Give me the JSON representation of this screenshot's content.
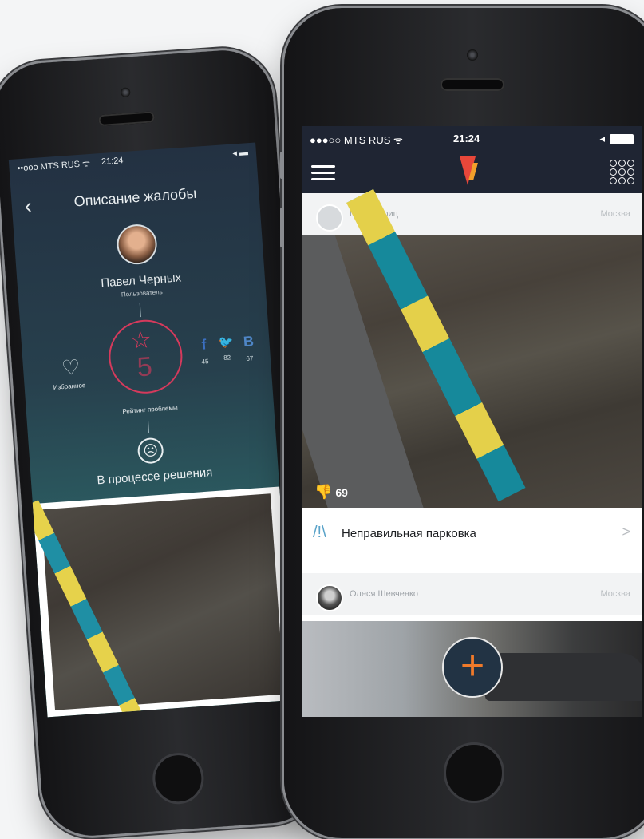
{
  "left_screen": {
    "status": {
      "carrier": "••ooo MTS RUS ᯤ",
      "time": "21:24",
      "signal": "◂ ▬"
    },
    "back_glyph": "‹",
    "title": "Описание жалобы",
    "user": {
      "name": "Павел Черных",
      "role": "Пользователь"
    },
    "favorite": {
      "glyph": "♡",
      "label": "Избранное"
    },
    "rating": {
      "glyph": "☆",
      "value": "5",
      "label": "Рейтинг проблемы"
    },
    "social": [
      {
        "icon": "facebook-icon",
        "glyph": "f",
        "count": "45",
        "color": "#3b6fbf"
      },
      {
        "icon": "twitter-icon",
        "glyph": "🐦",
        "count": "82",
        "color": "#2aa9e0"
      },
      {
        "icon": "vk-icon",
        "glyph": "B",
        "count": "67",
        "color": "#4f86c6"
      }
    ],
    "status_text": "В процессе решения",
    "status_glyph": "☹"
  },
  "right_screen": {
    "status": {
      "carrier": "●●●○○ MTS RUS ᯤ",
      "time": "21:24",
      "signal": "◂"
    },
    "posts": [
      {
        "author": "Павел Дриц",
        "location": "Москва",
        "dislikes": "69",
        "category": "Неправильная парковка",
        "category_glyph": "/!\\",
        "arrow": ">"
      },
      {
        "author": "Олеся Шевченко",
        "location": "Москва"
      }
    ],
    "dislike_glyph": "👎",
    "fab_glyph": "+"
  },
  "colors": {
    "accent": "#d53a5c",
    "nav_bg": "#1f2533",
    "fab": "#f07a2a"
  }
}
